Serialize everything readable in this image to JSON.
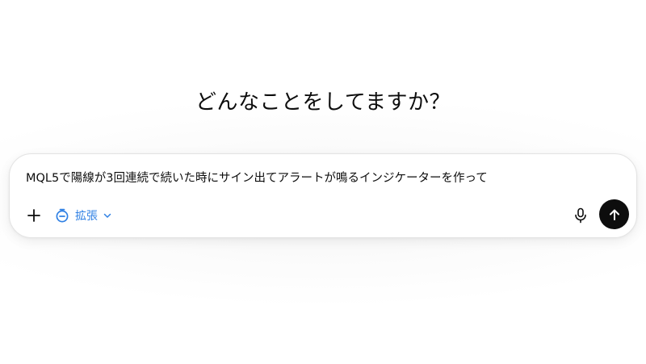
{
  "headline": "どんなことをしてますか？",
  "composer": {
    "prompt_text": "MQL5で陽線が3回連続で続いた時にサイン出てアラートが鳴るインジケーターを作って",
    "mode_label": "拡張",
    "accent_color": "#2f80e4",
    "send_button_color": "#0d0d0d",
    "icons": {
      "attach": "plus-icon",
      "mode": "timer-icon",
      "mode_menu": "chevron-down-icon",
      "voice": "microphone-icon",
      "send": "arrow-up-icon"
    }
  }
}
